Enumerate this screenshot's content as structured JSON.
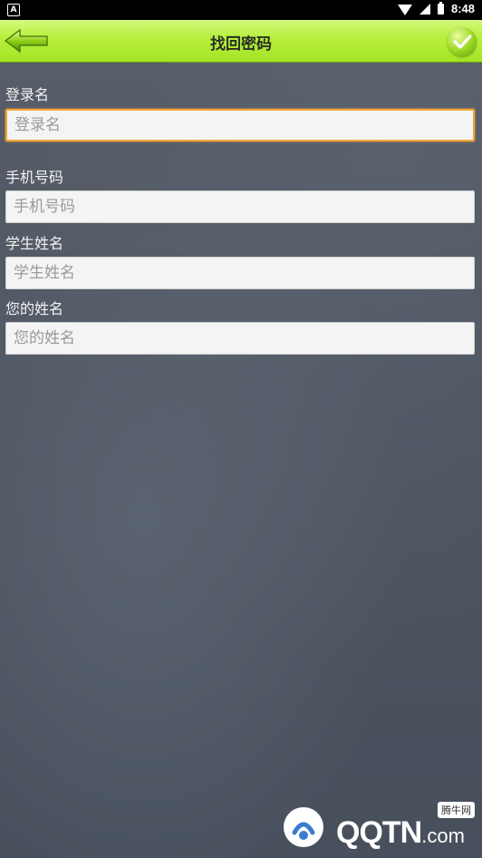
{
  "status_bar": {
    "time": "8:48",
    "notification_icon": "A"
  },
  "header": {
    "title": "找回密码",
    "back_icon": "green-arrow-left-icon",
    "confirm_icon": "check-circle-icon"
  },
  "form": {
    "fields": [
      {
        "label": "登录名",
        "placeholder": "登录名",
        "value": ""
      },
      {
        "label": "手机号码",
        "placeholder": "手机号码",
        "value": ""
      },
      {
        "label": "学生姓名",
        "placeholder": "学生姓名",
        "value": ""
      },
      {
        "label": "您的姓名",
        "placeholder": "您的姓名",
        "value": ""
      }
    ]
  },
  "watermark": {
    "text": "QQTN",
    "suffix": ".com",
    "badge": "腾牛网"
  },
  "colors": {
    "header_green": "#a4e423",
    "focus_orange": "#f0a63a"
  }
}
